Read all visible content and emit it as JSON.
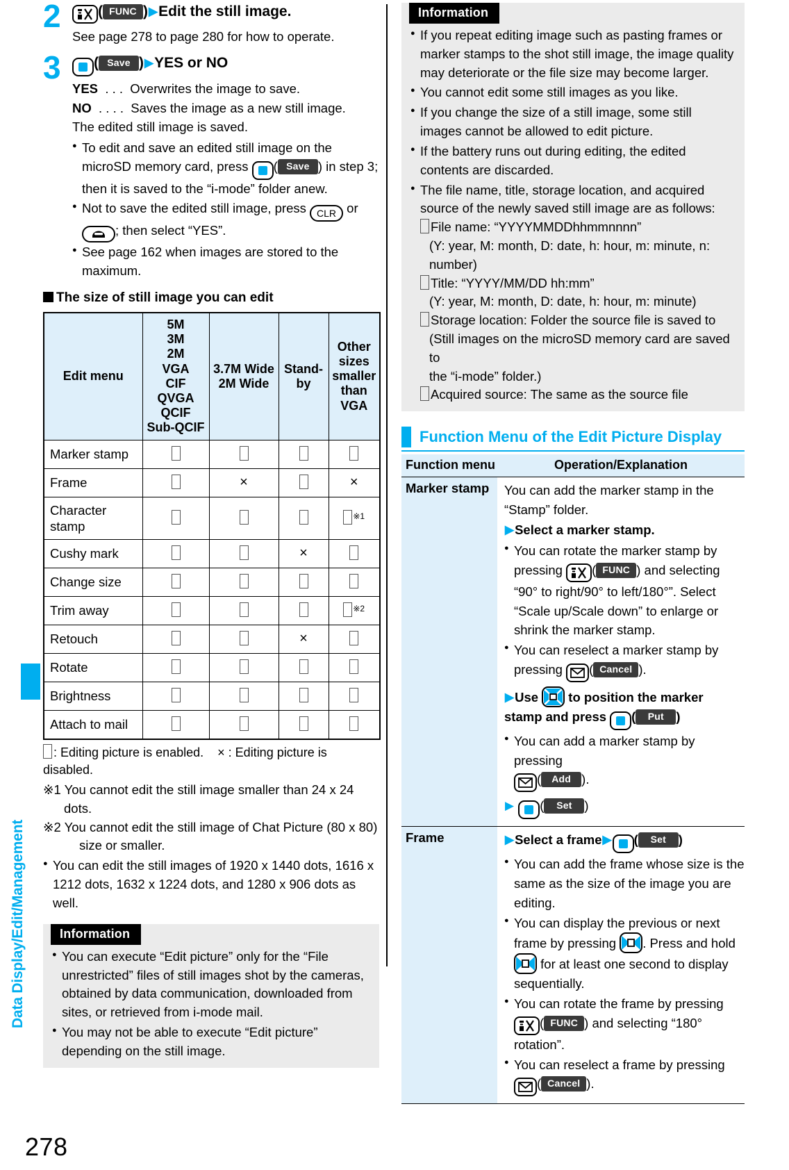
{
  "sidebar": {
    "chapter_label": "Data Display/Edit/Management",
    "accent_color": "#00AEEF"
  },
  "page_number": "278",
  "left_column": {
    "steps": [
      {
        "number": "2",
        "heading_keys": [
          {
            "type": "key-func",
            "glyph": "func-key-icon"
          },
          {
            "type": "chip",
            "label": "FUNC"
          }
        ],
        "heading_text": "Edit the still image.",
        "sub_text": "See page 278 to page 280 for how to operate."
      },
      {
        "number": "3",
        "heading_keys": [
          {
            "type": "key-center",
            "glyph": "center-key-icon"
          },
          {
            "type": "chip",
            "label": "Save"
          }
        ],
        "heading_text": "YES or NO",
        "lines": [
          {
            "bold": "YES",
            "dots": ". . .",
            "text": "Overwrites the image to save."
          },
          {
            "bold": "NO",
            "dots": ". . . .",
            "text": "Saves the image as a new still image."
          }
        ],
        "after_line": "The edited still image is saved.",
        "bullets": [
          "To edit and save an edited still image on the microSD memory card, press [CENTER]([Save]) in step 3; then it is saved to the “i-mode” folder anew.",
          "Not to save the edited still image, press [CLR] or [TEL]; then select “YES”.",
          "See page 162 when images are stored to the maximum."
        ],
        "bullet_parts": {
          "b1_a": "To edit and save an edited still image on the microSD memory card, press ",
          "b1_chip": "Save",
          "b1_b": ") in step 3; then it is saved to the “i-mode” folder anew.",
          "b2_a": "Not to save the edited still image, press ",
          "b2_clr": "CLR",
          "b2_mid": " or ",
          "b2_b": "; then select “YES”.",
          "b3": "See page 162 when images are stored to the maximum."
        }
      }
    ],
    "table_heading": "The size of still image you can edit",
    "size_table": {
      "columns": [
        "Edit menu",
        "5M\n3M\n2M\nVGA\nCIF\nQVGA\nQCIF\nSub-QCIF",
        "3.7M Wide\n2M Wide",
        "Stand-by",
        "Other\nsizes\nsmaller\nthan\nVGA"
      ],
      "rows": [
        {
          "menu": "Marker stamp",
          "vals": [
            "o",
            "o",
            "o",
            "o"
          ],
          "notes": [
            "",
            "",
            "",
            ""
          ]
        },
        {
          "menu": "Frame",
          "vals": [
            "o",
            "x",
            "o",
            "x"
          ],
          "notes": [
            "",
            "",
            "",
            ""
          ]
        },
        {
          "menu": "Character stamp",
          "vals": [
            "o",
            "o",
            "o",
            "o"
          ],
          "notes": [
            "",
            "",
            "",
            "※1"
          ]
        },
        {
          "menu": "Cushy mark",
          "vals": [
            "o",
            "o",
            "x",
            "o"
          ],
          "notes": [
            "",
            "",
            "",
            ""
          ]
        },
        {
          "menu": "Change size",
          "vals": [
            "o",
            "o",
            "o",
            "o"
          ],
          "notes": [
            "",
            "",
            "",
            ""
          ]
        },
        {
          "menu": "Trim away",
          "vals": [
            "o",
            "o",
            "o",
            "o"
          ],
          "notes": [
            "",
            "",
            "",
            "※2"
          ]
        },
        {
          "menu": "Retouch",
          "vals": [
            "o",
            "o",
            "x",
            "o"
          ],
          "notes": [
            "",
            "",
            "",
            ""
          ]
        },
        {
          "menu": "Rotate",
          "vals": [
            "o",
            "o",
            "o",
            "o"
          ],
          "notes": [
            "",
            "",
            "",
            ""
          ]
        },
        {
          "menu": "Brightness",
          "vals": [
            "o",
            "o",
            "o",
            "o"
          ],
          "notes": [
            "",
            "",
            "",
            ""
          ]
        },
        {
          "menu": "Attach to mail",
          "vals": [
            "o",
            "o",
            "o",
            "o"
          ],
          "notes": [
            "",
            "",
            "",
            ""
          ]
        }
      ]
    },
    "legend_enabled": ": Editing picture is enabled.",
    "legend_disabled": "× : Editing picture is disabled.",
    "footnote_1": "※1 You cannot edit the still image smaller than 24 x 24 dots.",
    "footnote_2": "※2 You cannot edit the still image of Chat Picture (80 x 80)",
    "footnote_2b": "size or smaller.",
    "extra_note": "You can edit the still images of 1920 x 1440 dots, 1616 x 1212 dots, 1632 x 1224 dots, and 1280 x 906 dots as well.",
    "information": {
      "title": "Information",
      "bullets": [
        "You can execute “Edit picture” only for the “File unrestricted” files of still images shot by the cameras, obtained by data communication, downloaded from sites, or retrieved from i-mode mail.",
        "You may not be able to execute “Edit picture” depending on the still image."
      ]
    }
  },
  "right_column": {
    "information": {
      "title": "Information",
      "bullets": [
        "If you repeat editing image such as pasting frames or marker stamps to the shot still image, the image quality may deteriorate or the file size may become larger.",
        "You cannot edit some still images as you like.",
        "If you change the size of a still image, some still images cannot be allowed to edit picture.",
        "If the battery runs out during editing, the edited contents are discarded.",
        "The file name, title, storage location, and acquired source of the newly saved still image are as follows:"
      ],
      "sub_lines": [
        {
          "indent": 1,
          "text": "File name: “YYYYMMDDhhmmnnnn”",
          "box": true
        },
        {
          "indent": 2,
          "text": "(Y: year, M: month, D: date, h: hour, m: minute, n: number)",
          "box": false
        },
        {
          "indent": 1,
          "text": "Title: “YYYY/MM/DD hh:mm”",
          "box": true
        },
        {
          "indent": 2,
          "text": "(Y: year, M: month, D: date, h: hour, m: minute)",
          "box": false
        },
        {
          "indent": 1,
          "text": "Storage location: Folder the source file is saved to",
          "box": true
        },
        {
          "indent": 2,
          "text": "(Still images on the microSD memory card are saved to",
          "box": false
        },
        {
          "indent": 2,
          "text": "the “i-mode” folder.)",
          "box": false
        },
        {
          "indent": 1,
          "text": "Acquired source: The same as the source file",
          "box": true
        }
      ]
    },
    "section_title": "Function Menu of the Edit Picture Display",
    "fn_table": {
      "header": {
        "col1": "Function menu",
        "col2": "Operation/Explanation"
      },
      "rows": [
        {
          "name": "Marker stamp",
          "intro": "You can add the marker stamp in the “Stamp” folder.",
          "step1": "Select a marker stamp.",
          "b1_a": "You can rotate the marker stamp by pressing ",
          "b1_chip": "FUNC",
          "b1_b": ") and selecting “90° to right/90° to left/180°”. Select “Scale up/Scale down” to enlarge or shrink the marker stamp.",
          "b2_a": "You can reselect a marker stamp by pressing ",
          "b2_chip": "Cancel",
          "b2_b": ").",
          "step2_a": "Use ",
          "step2_b": " to position the marker stamp and press ",
          "step2_chip": "Put",
          "b3_a": "You can add a marker stamp by pressing ",
          "b3_chip": "Add",
          "b3_b": ").",
          "step3_chip": "Set"
        },
        {
          "name": "Frame",
          "step1_a": "Select a frame",
          "step1_chip": "Set",
          "b1": "You can add the frame whose size is the same as the size of the image you are editing.",
          "b2_a": "You can display the previous or next frame by pressing ",
          "b2_mid": ". Press and hold ",
          "b2_b": " for at least one second to display sequentially.",
          "b3_a": "You can rotate the frame by pressing ",
          "b3_chip": "FUNC",
          "b3_b": ") and selecting “180° rotation”.",
          "b4_a": "You can reselect a frame by pressing ",
          "b4_chip": "Cancel",
          "b4_b": ")."
        }
      ]
    }
  },
  "icons": {
    "func_key": "func-key-icon",
    "center_key": "center-key-icon",
    "mail_key": "mail-key-icon",
    "clr_key": "clr-key-icon",
    "tel_key": "tel-key-icon",
    "nav_key": "navigation-key-icon",
    "nav_lr_key": "left-right-navigation-key-icon"
  }
}
